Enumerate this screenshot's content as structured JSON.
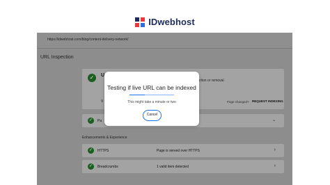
{
  "brand": {
    "name": "IDwebhost"
  },
  "url_bar": {
    "url": "https://idwebhost.com/blog/content-delivery-network/"
  },
  "page": {
    "section_title": "URL Inspection"
  },
  "inspection_card": {
    "partial_heading": "U",
    "partial_line": "V",
    "right_text": "ction or removal",
    "page_changed_label": "Page changed?",
    "request_indexing_label": "REQUEST INDEXING"
  },
  "coverage_row": {
    "partial_label": "Pa"
  },
  "enhancements": {
    "title": "Enhancements & Experience",
    "rows": [
      {
        "name": "HTTPS",
        "status": "Page is served over HTTPS"
      },
      {
        "name": "Breadcrumbs",
        "status": "1 valid item detected"
      }
    ]
  },
  "modal": {
    "title": "Testing if live URL can be indexed",
    "subtitle": "This might take a minute or two",
    "cancel_label": "Cancel",
    "progress": 0.35
  },
  "colors": {
    "accent": "#1a73e8",
    "check": "#1b5e20",
    "brand": "#1d2b59"
  }
}
